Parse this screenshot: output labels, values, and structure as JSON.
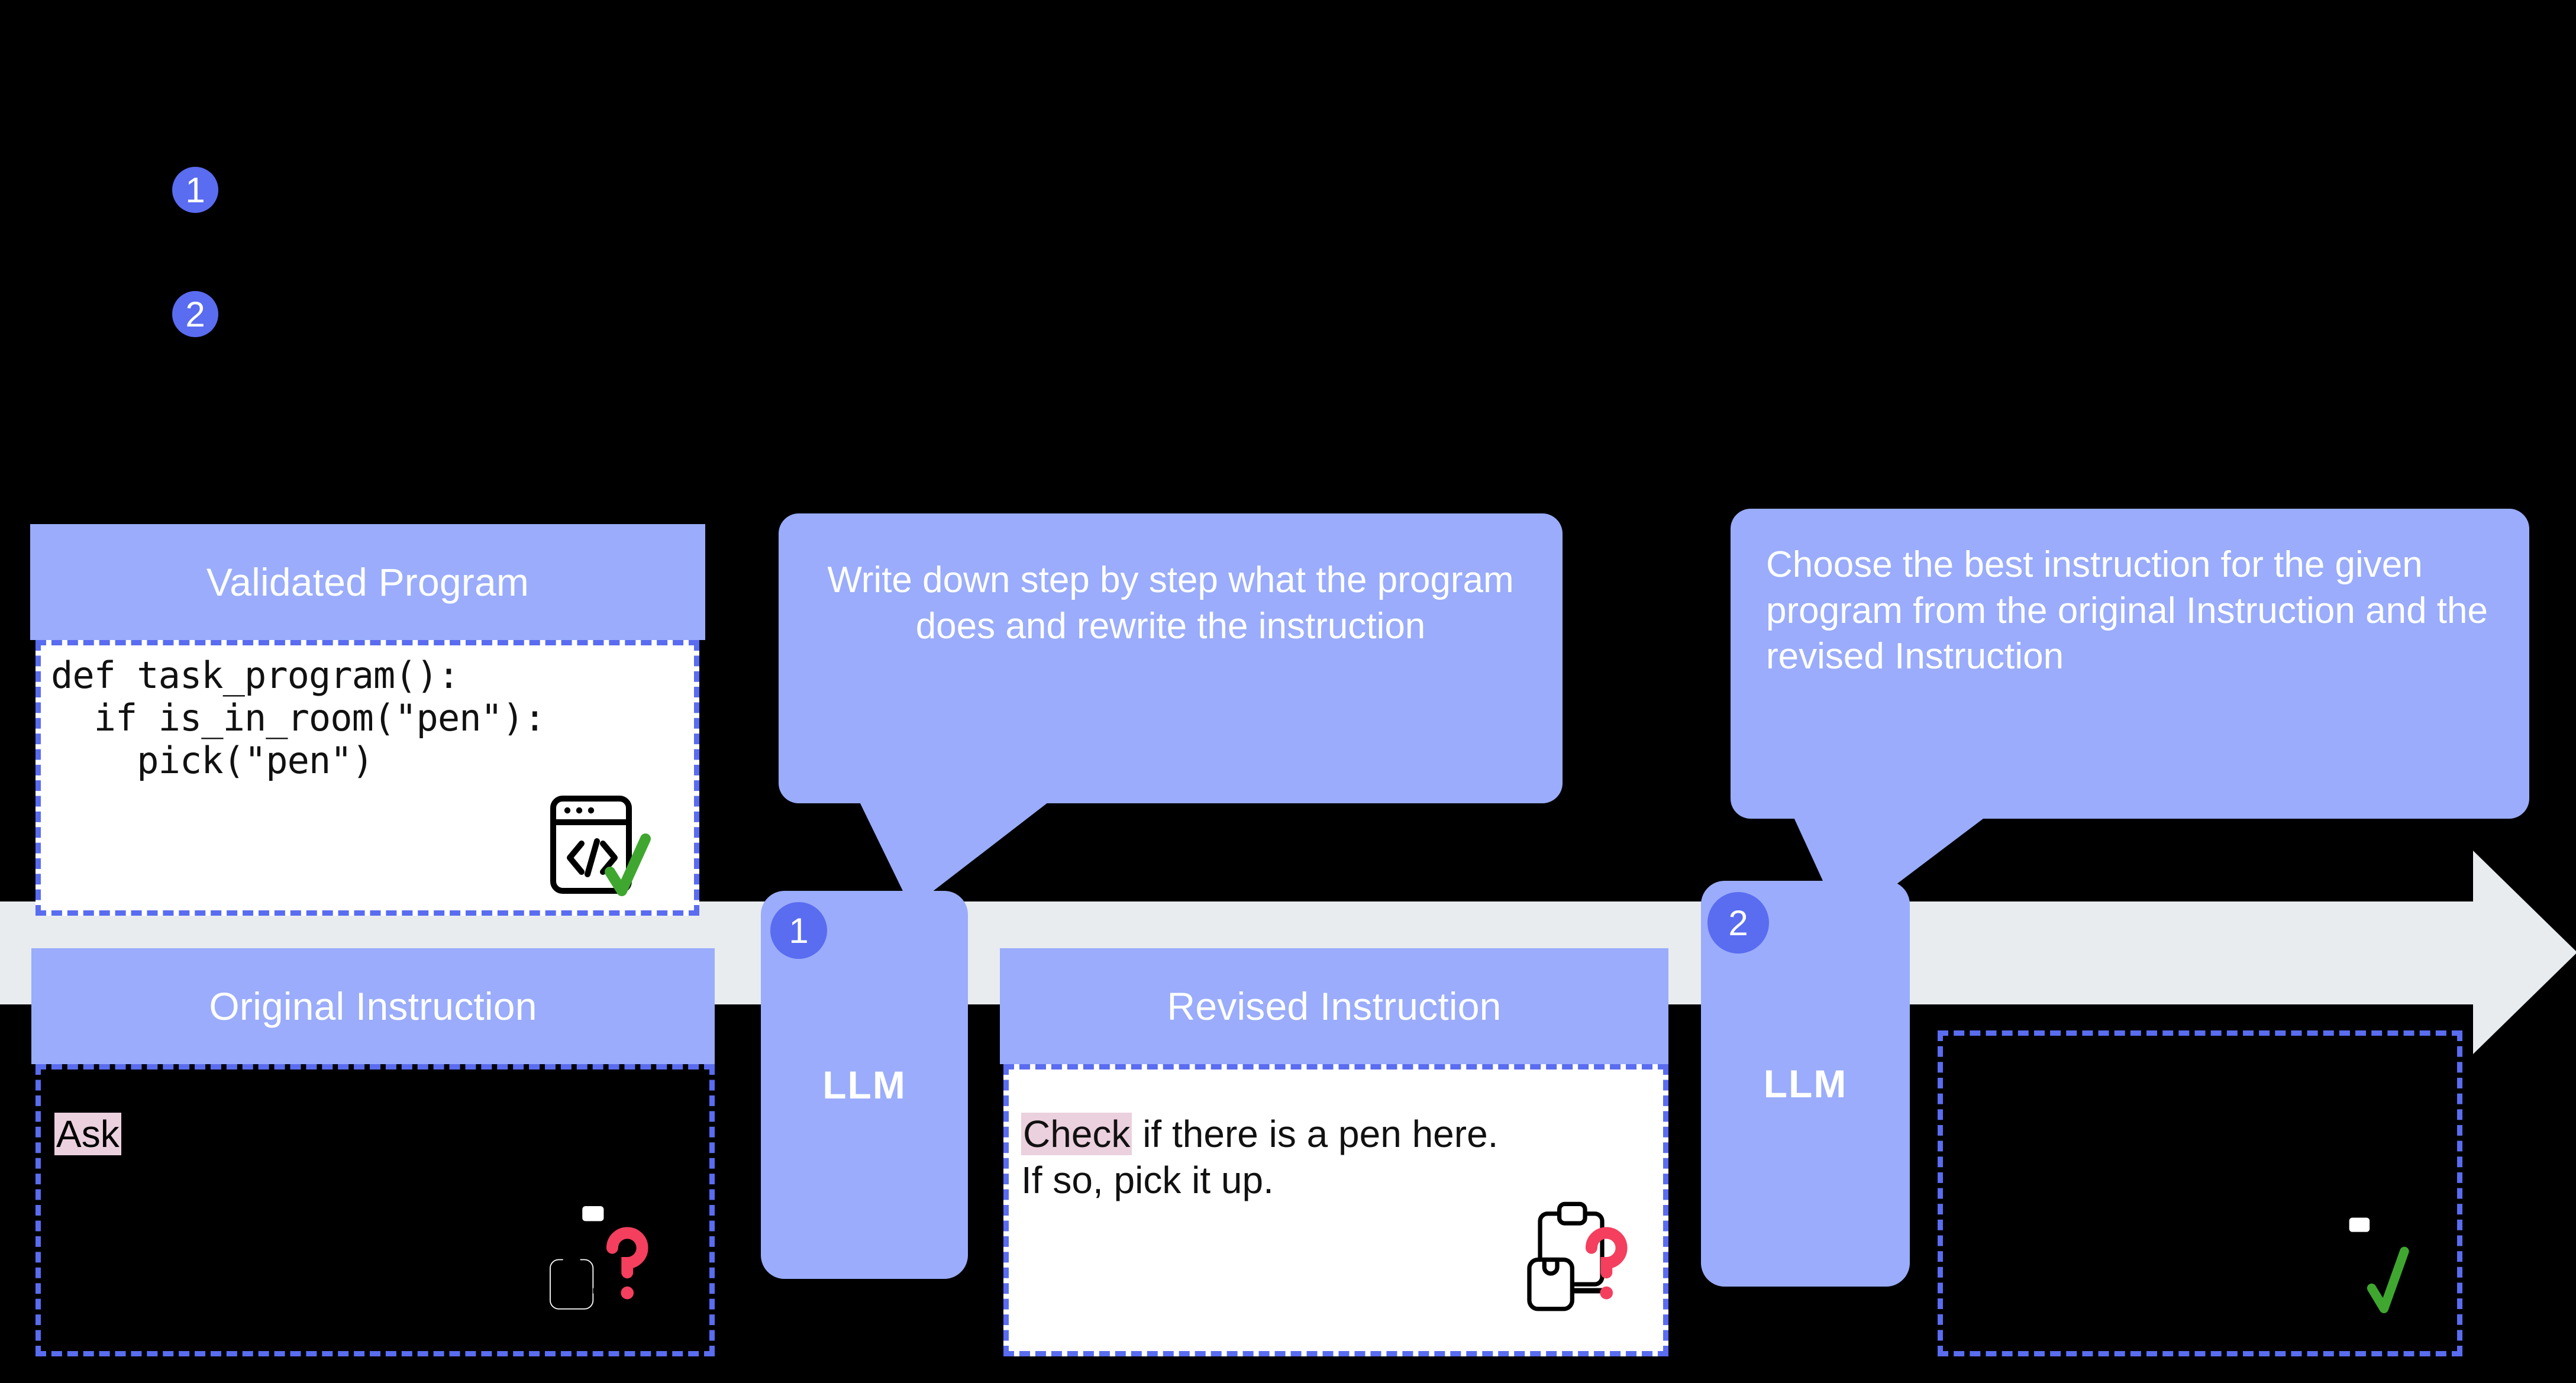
{
  "colors": {
    "background": "#000000",
    "lavender": "#9AACFB",
    "badge_blue": "#5A6CF0",
    "arrow_gray": "#E8ECEF",
    "dash_border": "#5A6CF0",
    "highlight_pink": "#EBD0DE",
    "check_green": "#3FA72F",
    "question_red": "#F43F5E",
    "text_white": "#FFFFFF",
    "text_black": "#111111"
  },
  "badges": {
    "top_one": "1",
    "top_two": "2",
    "llm_one": "1",
    "llm_two": "2"
  },
  "validated_program": {
    "title": "Validated Program",
    "code_lines": [
      "def task_program():",
      "  if is_in_room(\"pen\"):",
      "    pick(\"pen\")"
    ],
    "code_plain": "def task_program():\n  if is_in_room(\"pen\"):\n    pick(\"pen\")",
    "icon": "code-window-check-icon"
  },
  "original_instruction": {
    "title": "Original Instruction",
    "highlighted_word": "Ask",
    "body_text": "",
    "icon": "clipboard-question-icon"
  },
  "revised_instruction": {
    "title": "Revised Instruction",
    "highlighted_word": "Check",
    "line1_rest": " if there is a pen here.",
    "line2": "If so, pick it up.",
    "icon": "clipboard-question-icon"
  },
  "final_output": {
    "title": "",
    "icon": "clipboard-check-icon"
  },
  "bubbles": [
    {
      "id": "bubble-rewrite",
      "text": "Write down step by step what the program does  and rewrite the instruction",
      "align": "center"
    },
    {
      "id": "bubble-choose",
      "text": "Choose the best instruction for the given program from the original Instruction and the revised Instruction",
      "align": "left"
    }
  ],
  "llm_boxes": [
    {
      "id": "llm-1",
      "label": "LLM"
    },
    {
      "id": "llm-2",
      "label": "LLM"
    }
  ],
  "flow_arrow": {
    "direction": "right",
    "name": "process-flow-arrow"
  }
}
